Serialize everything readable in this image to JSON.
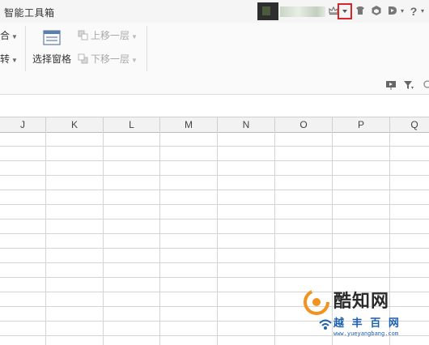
{
  "topbar": {
    "tab_title": "智能工具箱",
    "help_label": "?",
    "icons": [
      "user-avatar",
      "crown-icon",
      "dropdown-caret-icon",
      "skin-icon",
      "cube-icon",
      "share-icon",
      "help-icon"
    ]
  },
  "ribbon": {
    "merge_label": "合",
    "rotate_label": "转",
    "selection_pane_label": "选择窗格",
    "bring_forward_label": "上移一层",
    "send_backward_label": "下移一层",
    "right_icons": [
      "presentation-icon",
      "filter-icon"
    ]
  },
  "sheet": {
    "columns": [
      "J",
      "K",
      "L",
      "M",
      "N",
      "O",
      "P",
      "Q"
    ]
  },
  "watermark": {
    "brand_cn": "酷知网",
    "brand_cn2": "越 丰 百 网",
    "url": "www.yueyangbang.com"
  },
  "colors": {
    "highlight": "#d9252b",
    "watermark_blue": "#1b5fae",
    "watermark_orange": "#f29320"
  }
}
